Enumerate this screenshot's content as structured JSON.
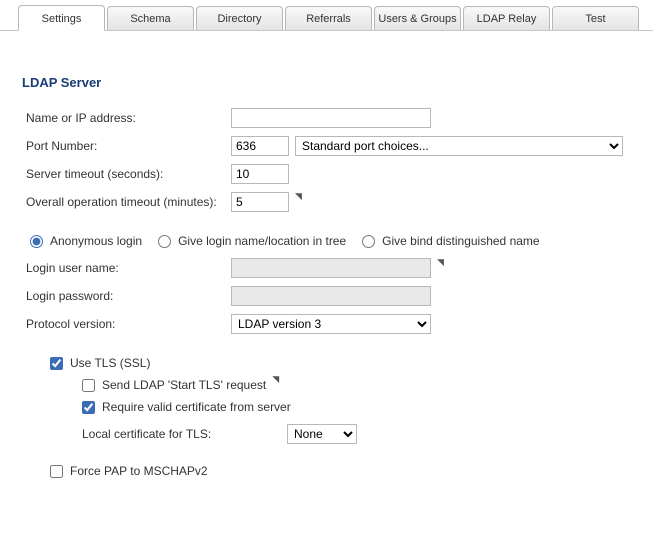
{
  "tabs": {
    "items": [
      {
        "label": "Settings",
        "active": true
      },
      {
        "label": "Schema"
      },
      {
        "label": "Directory"
      },
      {
        "label": "Referrals"
      },
      {
        "label": "Users & Groups"
      },
      {
        "label": "LDAP Relay"
      },
      {
        "label": "Test"
      }
    ]
  },
  "section_title": "LDAP Server",
  "labels": {
    "name_or_ip": "Name or IP address:",
    "port_number": "Port Number:",
    "server_timeout": "Server timeout (seconds):",
    "overall_timeout": "Overall operation timeout (minutes):",
    "login_user": "Login user name:",
    "login_pass": "Login password:",
    "protocol": "Protocol version:",
    "local_cert": "Local certificate for TLS:"
  },
  "values": {
    "name_or_ip": "",
    "port_number": "636",
    "server_timeout": "10",
    "overall_timeout": "5",
    "login_user": "",
    "login_pass": ""
  },
  "selects": {
    "port_choice": "Standard port choices...",
    "protocol": "LDAP version 3",
    "local_cert": "None"
  },
  "radios": {
    "anonymous": "Anonymous login",
    "login_name": "Give login name/location in tree",
    "dn": "Give bind distinguished name"
  },
  "checks": {
    "use_tls": "Use TLS (SSL)",
    "start_tls": "Send LDAP 'Start TLS' request",
    "require_cert": "Require valid certificate from server",
    "force_pap": "Force PAP to MSCHAPv2"
  }
}
